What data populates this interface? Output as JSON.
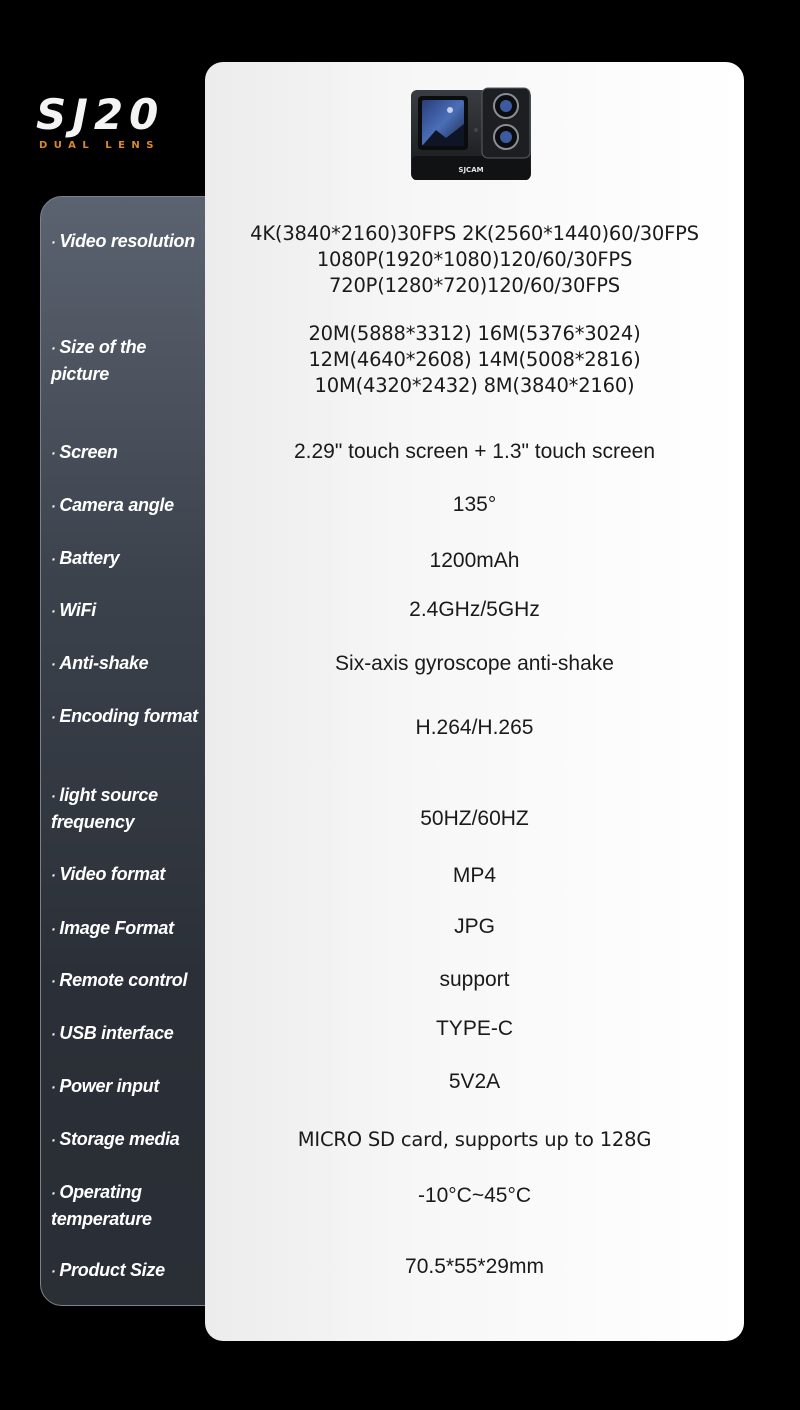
{
  "brand": {
    "model": "SJ20",
    "tagline": "DUAL LENS",
    "camera_logo": "SJCAM"
  },
  "colors": {
    "background": "#000000",
    "accent": "#d98a2b",
    "label_text": "#ffffff",
    "value_text": "#1a1a1a"
  },
  "specs": [
    {
      "label": "Video resolution",
      "values": [
        "4K(3840*2160)30FPS   2K(2560*1440)60/30FPS",
        "1080P(1920*1080)120/60/30FPS",
        "720P(1280*720)120/60/30FPS"
      ]
    },
    {
      "label": "Size of the picture",
      "values": [
        "20M(5888*3312)  16M(5376*3024)",
        "12M(4640*2608)  14M(5008*2816)",
        "10M(4320*2432)  8M(3840*2160)"
      ]
    },
    {
      "label": "Screen",
      "values": [
        "2.29\" touch screen + 1.3\" touch screen"
      ]
    },
    {
      "label": "Camera angle",
      "values": [
        "135°"
      ]
    },
    {
      "label": "Battery",
      "values": [
        "1200mAh"
      ]
    },
    {
      "label": "WiFi",
      "values": [
        "2.4GHz/5GHz"
      ]
    },
    {
      "label": "Anti-shake",
      "values": [
        "Six-axis gyroscope anti-shake"
      ]
    },
    {
      "label": "Encoding format",
      "values": [
        "H.264/H.265"
      ]
    },
    {
      "label": "light source frequency",
      "values": [
        "50HZ/60HZ"
      ]
    },
    {
      "label": "Video format",
      "values": [
        "MP4"
      ]
    },
    {
      "label": "Image Format",
      "values": [
        "JPG"
      ]
    },
    {
      "label": "Remote control",
      "values": [
        "support"
      ]
    },
    {
      "label": "USB interface",
      "values": [
        "TYPE-C"
      ]
    },
    {
      "label": "Power input",
      "values": [
        "5V2A"
      ]
    },
    {
      "label": "Storage media",
      "values": [
        "MICRO SD card, supports up to 128G"
      ]
    },
    {
      "label": "Operating temperature",
      "values": [
        "-10°C~45°C"
      ]
    },
    {
      "label": "Product Size",
      "values": [
        "70.5*55*29mm"
      ]
    }
  ]
}
